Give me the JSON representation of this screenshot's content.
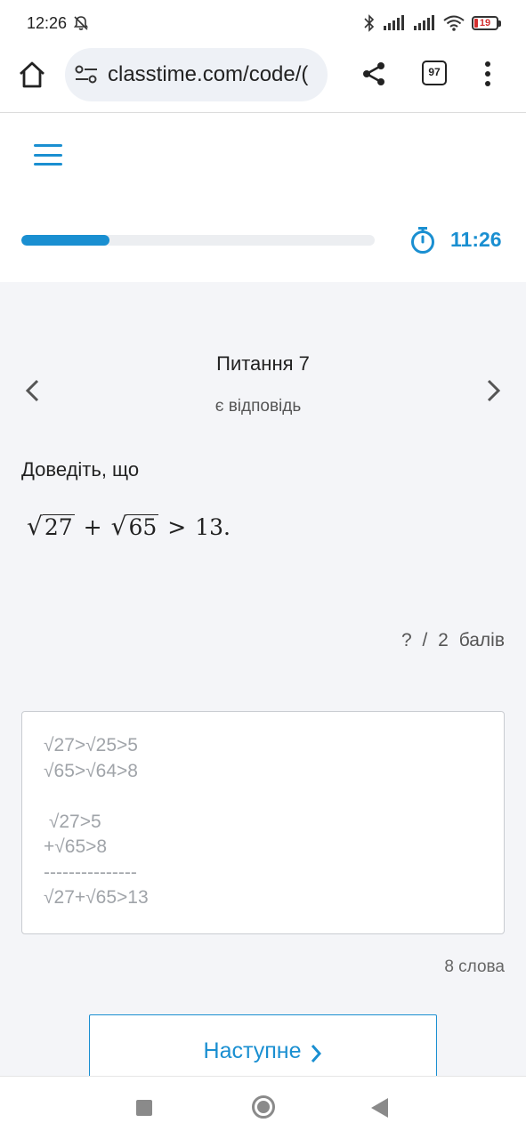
{
  "status_bar": {
    "time": "12:26",
    "battery": "19"
  },
  "browser": {
    "url": "classtime.com/code/(",
    "tab_count": "97"
  },
  "quiz": {
    "progress_fraction": 0.25,
    "timer": "11:26",
    "question_title": "Питання 7",
    "question_status": "є відповідь",
    "question_intro": "Доведіть, що",
    "formula": {
      "a": "27",
      "plus": "+",
      "b": "65",
      "gt": ">",
      "c": "13."
    },
    "points": "?  /  2  балів",
    "answer_text": "√27>√25>5\n√65>√64>8\n\n √27>5\n+√65>8\n---------------\n√27+√65>13",
    "word_count": "8 слова",
    "next_label": "Наступне",
    "accent_color": "#1a8fd1"
  },
  "icons": {
    "home": "home-icon",
    "site_settings": "tune-icon",
    "share": "share-icon",
    "menu": "more-vert-icon",
    "hamburger": "hamburger-icon",
    "timer": "stopwatch-icon",
    "prev": "chevron-left-icon",
    "next": "chevron-right-icon"
  }
}
